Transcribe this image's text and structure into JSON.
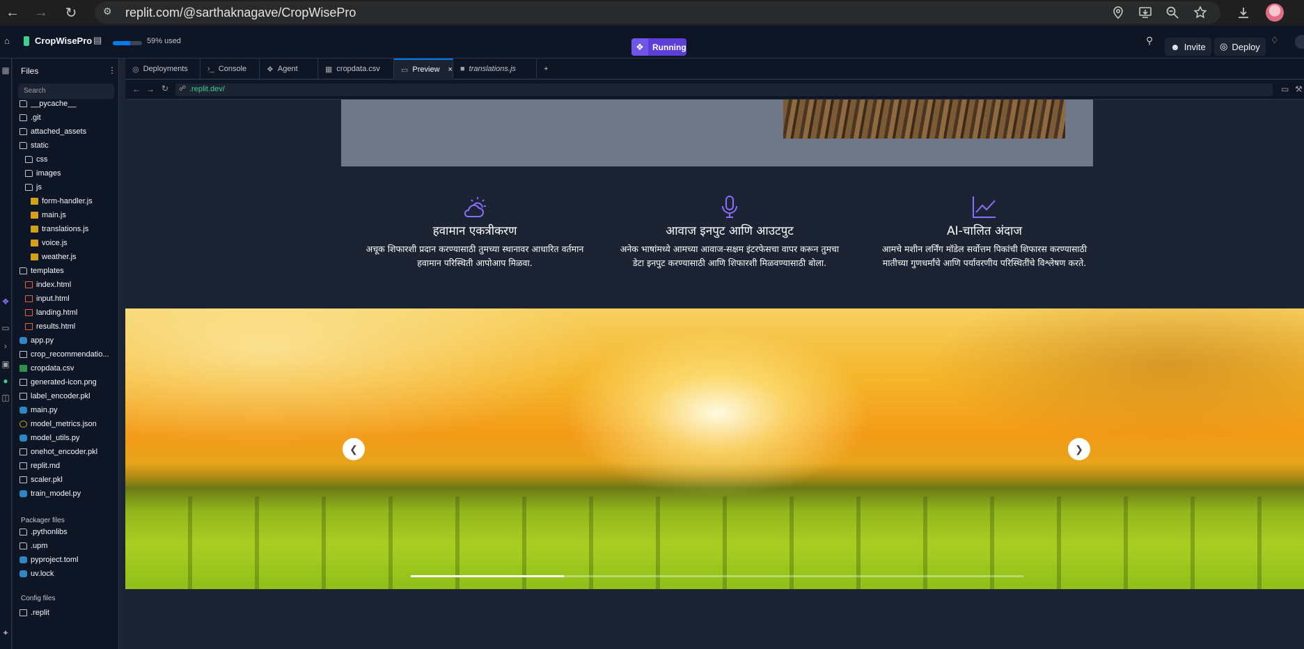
{
  "browser": {
    "url": "replit.com/@sarthaknagave/CropWisePro"
  },
  "header": {
    "project_name": "CropWisePro",
    "usage_text": "59% used",
    "usage_fraction": 0.59,
    "status": "Running",
    "invite_label": "Invite",
    "deploy_label": "Deploy"
  },
  "files": {
    "title": "Files",
    "search_placeholder": "Search",
    "tree": [
      {
        "name": "__pycache__",
        "type": "folder",
        "depth": 0
      },
      {
        "name": ".git",
        "type": "folder",
        "depth": 0
      },
      {
        "name": "attached_assets",
        "type": "folder",
        "depth": 0
      },
      {
        "name": "static",
        "type": "folder",
        "depth": 0
      },
      {
        "name": "css",
        "type": "folder",
        "depth": 1
      },
      {
        "name": "images",
        "type": "folder",
        "depth": 1
      },
      {
        "name": "js",
        "type": "folder",
        "depth": 1
      },
      {
        "name": "form-handler.js",
        "type": "js",
        "depth": 2
      },
      {
        "name": "main.js",
        "type": "js",
        "depth": 2
      },
      {
        "name": "translations.js",
        "type": "js",
        "depth": 2
      },
      {
        "name": "voice.js",
        "type": "js",
        "depth": 2
      },
      {
        "name": "weather.js",
        "type": "js",
        "depth": 2
      },
      {
        "name": "templates",
        "type": "folder",
        "depth": 0
      },
      {
        "name": "index.html",
        "type": "html",
        "depth": 1
      },
      {
        "name": "input.html",
        "type": "html",
        "depth": 1
      },
      {
        "name": "landing.html",
        "type": "html",
        "depth": 1
      },
      {
        "name": "results.html",
        "type": "html",
        "depth": 1
      },
      {
        "name": "app.py",
        "type": "py",
        "depth": 0
      },
      {
        "name": "crop_recommendatio...",
        "type": "file",
        "depth": 0
      },
      {
        "name": "cropdata.csv",
        "type": "csv",
        "depth": 0
      },
      {
        "name": "generated-icon.png",
        "type": "file",
        "depth": 0
      },
      {
        "name": "label_encoder.pkl",
        "type": "file",
        "depth": 0
      },
      {
        "name": "main.py",
        "type": "py",
        "depth": 0
      },
      {
        "name": "model_metrics.json",
        "type": "json",
        "depth": 0
      },
      {
        "name": "model_utils.py",
        "type": "py",
        "depth": 0
      },
      {
        "name": "onehot_encoder.pkl",
        "type": "file",
        "depth": 0
      },
      {
        "name": "replit.md",
        "type": "file",
        "depth": 0
      },
      {
        "name": "scaler.pkl",
        "type": "file",
        "depth": 0
      },
      {
        "name": "train_model.py",
        "type": "py",
        "depth": 0
      }
    ],
    "packager_title": "Packager files",
    "packager": [
      {
        "name": ".pythonlibs",
        "type": "folder"
      },
      {
        "name": ".upm",
        "type": "folder"
      },
      {
        "name": "pyproject.toml",
        "type": "py"
      },
      {
        "name": "uv.lock",
        "type": "py"
      }
    ],
    "config_title": "Config files",
    "config": [
      {
        "name": ".replit",
        "type": "file"
      }
    ]
  },
  "tabs": [
    {
      "label": "Deployments",
      "icon": "deploy-icon"
    },
    {
      "label": "Console",
      "icon": "terminal-icon"
    },
    {
      "label": "Agent",
      "icon": "agent-icon"
    },
    {
      "label": "cropdata.csv",
      "icon": "csv-icon"
    },
    {
      "label": "Preview",
      "icon": "preview-icon",
      "active": true
    },
    {
      "label": "translations.js",
      "icon": "js-icon"
    }
  ],
  "preview": {
    "address": ".replit.dev/",
    "features": [
      {
        "icon": "cloud-sun-icon",
        "title": "हवामान एकत्रीकरण",
        "text": "अचूक शिफारशी प्रदान करण्यासाठी तुमच्या स्थानावर आधारित वर्तमान हवामान परिस्थिती आपोआप मिळवा."
      },
      {
        "icon": "microphone-icon",
        "title": "आवाज इनपुट आणि आउटपुट",
        "text": "अनेक भाषांमध्ये आमच्या आवाज-सक्षम इंटरफेसचा वापर करून तुमचा डेटा इनपुट करण्यासाठी आणि शिफारशी मिळवण्यासाठी बोला."
      },
      {
        "icon": "chart-line-icon",
        "title": "AI-चालित अंदाज",
        "text": "आमचे मशीन लर्निंग मॉडेल सर्वोत्तम पिकांची शिफारस करण्यासाठी मातीच्या गुणधर्मांचे आणि पर्यावरणीय परिस्थितींचे विश्लेषण करते."
      }
    ],
    "carousel_progress": 0.25
  }
}
